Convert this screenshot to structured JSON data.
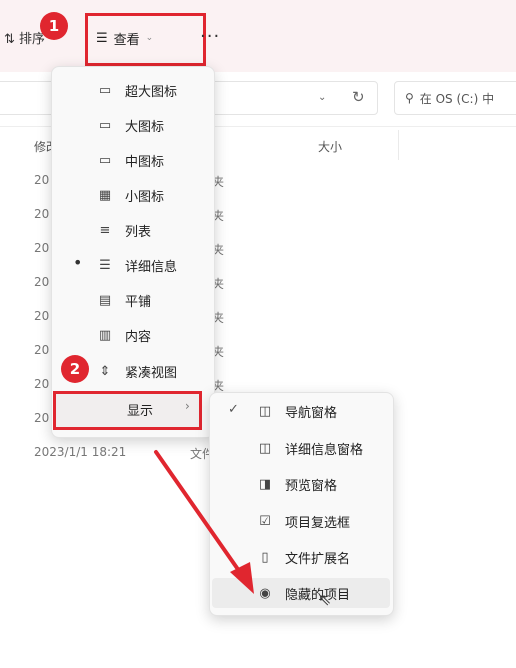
{
  "toolbar": {
    "sort_label": "排序",
    "view_label": "查看",
    "more_label": "···"
  },
  "badges": {
    "first": "1",
    "second": "2"
  },
  "address_bar": {
    "refresh_icon": "refresh-icon"
  },
  "search": {
    "placeholder": "在 OS (C:) 中"
  },
  "columns": {
    "modified": "修改",
    "size": "大小"
  },
  "rows": [
    {
      "date": "20",
      "type": "夹"
    },
    {
      "date": "20",
      "type": "夹"
    },
    {
      "date": "20",
      "type": "夹"
    },
    {
      "date": "20",
      "type": "夹"
    },
    {
      "date": "20",
      "type": "夹"
    },
    {
      "date": "20",
      "type": "夹"
    },
    {
      "date": "20",
      "type": "夹"
    },
    {
      "date": "20",
      "type": ""
    },
    {
      "date": "2023/1/1 18:21",
      "type": "文件"
    }
  ],
  "view_menu": {
    "items": [
      {
        "label": "超大图标",
        "icon": "monitor-icon"
      },
      {
        "label": "大图标",
        "icon": "monitor-icon"
      },
      {
        "label": "中图标",
        "icon": "monitor-icon"
      },
      {
        "label": "小图标",
        "icon": "grid-icon"
      },
      {
        "label": "列表",
        "icon": "list-icon"
      },
      {
        "label": "详细信息",
        "icon": "details-icon",
        "selected": true
      },
      {
        "label": "平铺",
        "icon": "tiles-icon"
      },
      {
        "label": "内容",
        "icon": "content-icon"
      },
      {
        "label": "紧凑视图",
        "icon": "compact-icon"
      }
    ],
    "show_label": "显示"
  },
  "show_submenu": {
    "items": [
      {
        "label": "导航窗格",
        "icon": "nav-pane-icon",
        "checked": true
      },
      {
        "label": "详细信息窗格",
        "icon": "details-pane-icon"
      },
      {
        "label": "预览窗格",
        "icon": "preview-pane-icon"
      },
      {
        "label": "项目复选框",
        "icon": "checkbox-icon"
      },
      {
        "label": "文件扩展名",
        "icon": "file-icon"
      },
      {
        "label": "隐藏的项目",
        "icon": "eye-icon",
        "hovered": true
      }
    ]
  },
  "colors": {
    "highlight": "#e0262f",
    "menu_bg": "#f9f9f9",
    "toolbar_bg": "#fbf2f3"
  }
}
